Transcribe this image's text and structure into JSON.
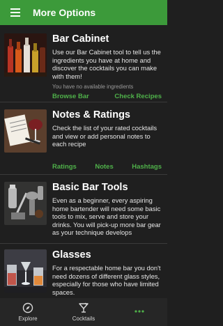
{
  "app": {
    "title": "More Options"
  },
  "cards": [
    {
      "title": "Bar Cabinet",
      "description": "Use our Bar Cabinet tool to tell us the ingredients you have at home and discover the cocktails you can make with them!",
      "note": "You have no available ingredients",
      "actions": [
        "Browse Bar",
        "Check Recipes"
      ]
    },
    {
      "title": "Notes & Ratings",
      "description": "Check the list of your rated cocktails and view or add personal notes to each recipe",
      "actions": [
        "Ratings",
        "Notes",
        "Hashtags"
      ]
    },
    {
      "title": "Basic Bar Tools",
      "description": "Even as a beginner, every aspiring home bartender will need some basic tools to mix, serve and store your drinks. You will pick-up more bar gear as your technique develops"
    },
    {
      "title": "Glasses",
      "description": "For a respectable home bar you don't need dozens of different glass styles, especially for those who have limited spaces."
    }
  ],
  "bottom_nav": [
    {
      "label": "Explore",
      "icon": "compass-icon"
    },
    {
      "label": "Cocktails",
      "icon": "cocktail-glass-icon"
    },
    {
      "label": "",
      "icon": "more-dots-icon"
    }
  ],
  "colors": {
    "accent": "#3c9a3a",
    "action_text": "#4fb14a",
    "background": "#1f1f1f"
  }
}
